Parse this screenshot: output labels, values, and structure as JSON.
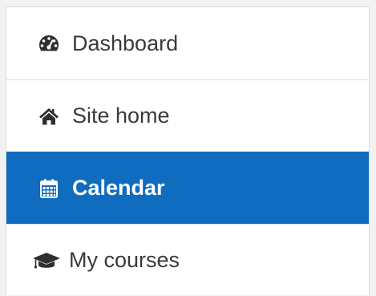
{
  "nav": {
    "items": [
      {
        "label": "Dashboard",
        "icon": "dashboard-icon",
        "active": false
      },
      {
        "label": "Site home",
        "icon": "home-icon",
        "active": false
      },
      {
        "label": "Calendar",
        "icon": "calendar-icon",
        "active": true
      },
      {
        "label": "My courses",
        "icon": "graduation-cap-icon",
        "active": false
      }
    ]
  },
  "colors": {
    "active_background": "#0f6cbf",
    "active_text": "#ffffff",
    "text": "#3a3a3a",
    "divider": "#dedede"
  }
}
